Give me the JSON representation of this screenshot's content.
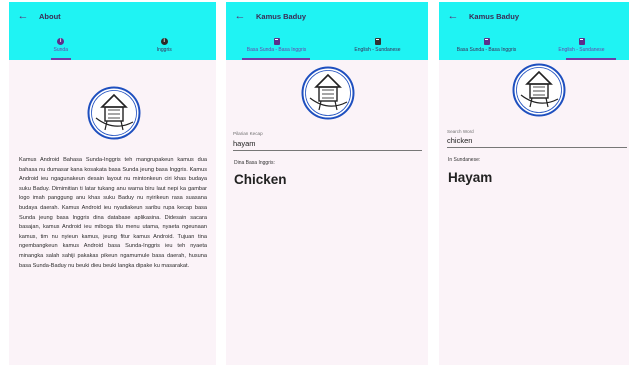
{
  "screens": [
    {
      "title": "About",
      "tabs": [
        {
          "label": "Sunda",
          "icon": "info-icon",
          "active": true
        },
        {
          "label": "Inggris",
          "icon": "info-icon",
          "active": false
        }
      ],
      "logo_text": "Kamus Baduy",
      "body": "Kamus Android Bahasa Sunda-Inggris teh mangrupakeun kamus dua bahasa nu dumasar kana kosakata basa Sunda jeung basa Inggris. Kamus Android ieu ngagunakeun desain layout nu mintonkeun ciri khas budaya suku Baduy. Dimimitian ti latar tukang anu warna biru laut nepi ka gambar logo imah panggung anu khas suku Baduy nu nyirikeun rasa suasana budaya daerah. Kamus Android ieu nyadiakeun saribu rupa kecap basa Sunda jeung basa Inggris dina database aplikasina. Didesain sacara basajan, kamus Android ieu miboga tilu menu utama, nyaeta ngeunaan kamus, tim nu nyieun kamus, jeung fitur kamus Android. Tujuan tina ngembangkeun kamus Android basa Sunda-Inggris ieu teh nyaeta minangka salah sahiji pakakas pikeun ngamumule basa daerah, husuna basa Sunda-Baduy nu beuki dieu beuki langka dipake ku masarakat."
    },
    {
      "title": "Kamus Baduy",
      "tabs": [
        {
          "label": "Basa Sunda - Basa Inggris",
          "icon": "book-icon",
          "active": true
        },
        {
          "label": "English - Sundanese",
          "icon": "book-icon",
          "active": false
        }
      ],
      "logo_text": "Kamus Baduy",
      "input_label": "Pilarian Kecap",
      "input_value": "hayam",
      "result_label": "Dina Basa Inggris:",
      "result_value": "Chicken"
    },
    {
      "title": "Kamus Baduy",
      "tabs": [
        {
          "label": "Basa Sunda - Basa Inggris",
          "icon": "book-icon",
          "active": false
        },
        {
          "label": "English - Sundanese",
          "icon": "book-icon",
          "active": true
        }
      ],
      "logo_text": "Kamus Baduy",
      "input_label": "Search Word",
      "input_value": "chicken",
      "result_label": "In Sundanese:",
      "result_value": "Hayam"
    }
  ],
  "colors": {
    "appbar": "#1ff3f3",
    "accent": "#6b3fa8",
    "background": "#fbf3f8",
    "logo_ring": "#1e4fbf"
  }
}
